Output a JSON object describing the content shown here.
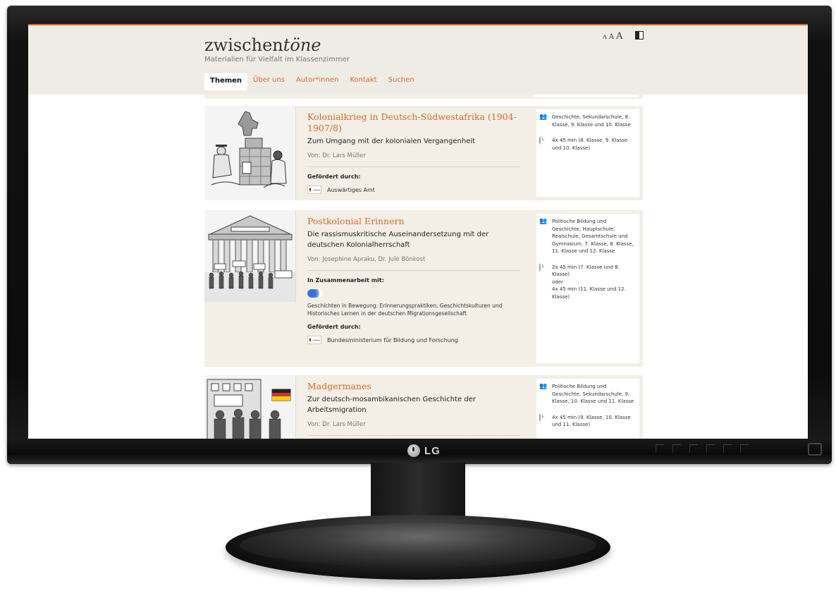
{
  "site": {
    "title_plain": "zwischen",
    "title_italic": "töne",
    "tagline": "Materialien für Vielfalt im Klassenzimmer",
    "font_size_labels": [
      "A",
      "A",
      "A"
    ]
  },
  "nav": [
    {
      "label": "Themen",
      "active": true
    },
    {
      "label": "Über uns",
      "active": false
    },
    {
      "label": "Autor*innen",
      "active": false
    },
    {
      "label": "Kontakt",
      "active": false
    },
    {
      "label": "Suchen",
      "active": false
    }
  ],
  "cards": [
    {
      "title": "Kolonialkrieg in Deutsch-Südwestafrika (1904-1907/8)",
      "subtitle": "Zum Umgang mit der kolonialen Vergangenheit",
      "author": "Von: Dr. Lars Müller",
      "funded_label": "Gefördert durch:",
      "funder": "Auswärtiges Amt",
      "subjects": "Geschichte, Sekundarschule, 8. Klasse, 9. Klasse und 10. Klasse",
      "duration": "4x 45 min (8. Klasse, 9. Klasse und 10. Klasse)"
    },
    {
      "title": "Postkolonial Erinnern",
      "subtitle": "Die rassismuskritische Auseinandersetzung mit der deutschen Kolonialherrschaft",
      "author": "Von: Josephine Apraku, Dr. Jule Bönkost",
      "coop_label": "In Zusammenarbeit mit:",
      "coop_text": "Geschichten in Bewegung: Erinnerungspraktiken, Geschichtskulturen und Historisches Lernen in der deutschen Migrationsgesellschaft",
      "funded_label": "Gefördert durch:",
      "funder": "Bundesministerium für Bildung und Forschung",
      "subjects": "Politische Bildung und Geschichte, Hauptschule, Realschule, Gesamtschule und Gymnasium, 7. Klasse, 8. Klasse, 11. Klasse und 12. Klasse",
      "duration_1": "2x 45 min (7. Klasse und 8. Klasse)",
      "duration_or": "oder",
      "duration_2": "4x 45 min (11. Klasse und 12. Klasse)"
    },
    {
      "title": "Madgermanes",
      "subtitle": "Zur deutsch-mosambikanischen Geschichte der Arbeitsmigration",
      "author": "Von: Dr. Lars Müller",
      "subjects": "Politische Bildung und Geschichte, Sekundarschule, 9. Klasse, 10. Klasse und 11. Klasse",
      "duration": "4x 45 min (9. Klasse, 10. Klasse und 11. Klasse)"
    }
  ],
  "monitor": {
    "brand": "LG"
  },
  "colors": {
    "accent": "#d96a2b",
    "card_bg": "#f3efe7",
    "header_bg": "#efece5"
  }
}
